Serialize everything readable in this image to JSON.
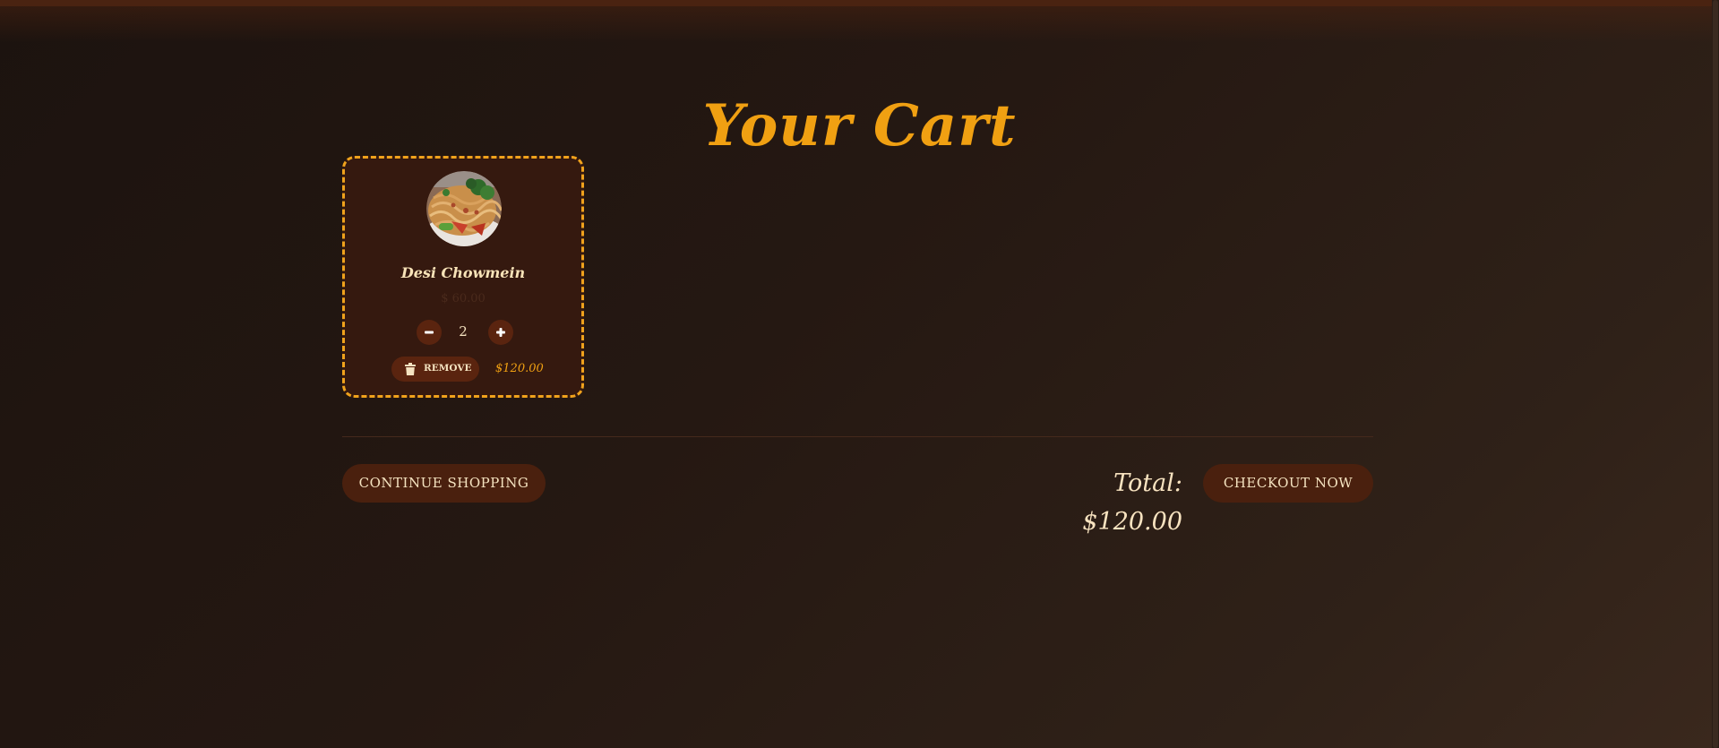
{
  "page": {
    "title": "Your Cart"
  },
  "cart": {
    "items": [
      {
        "name": "Desi Chowmein",
        "unit_price": "$ 60.00",
        "quantity": "2",
        "remove_label": "REMOVE",
        "line_total": "$120.00",
        "image_icon": "food-photo"
      }
    ],
    "icons": {
      "minus": "minus-icon",
      "plus": "plus-icon",
      "trash": "trash-icon"
    }
  },
  "footer": {
    "continue_label": "CONTINUE SHOPPING",
    "total_text": "Total: $120.00",
    "checkout_label": "CHECKOUT NOW"
  },
  "colors": {
    "accent": "#f0a012",
    "button": "#4a200e",
    "card_bg": "#35190f",
    "text_light": "#f5e3c0"
  }
}
